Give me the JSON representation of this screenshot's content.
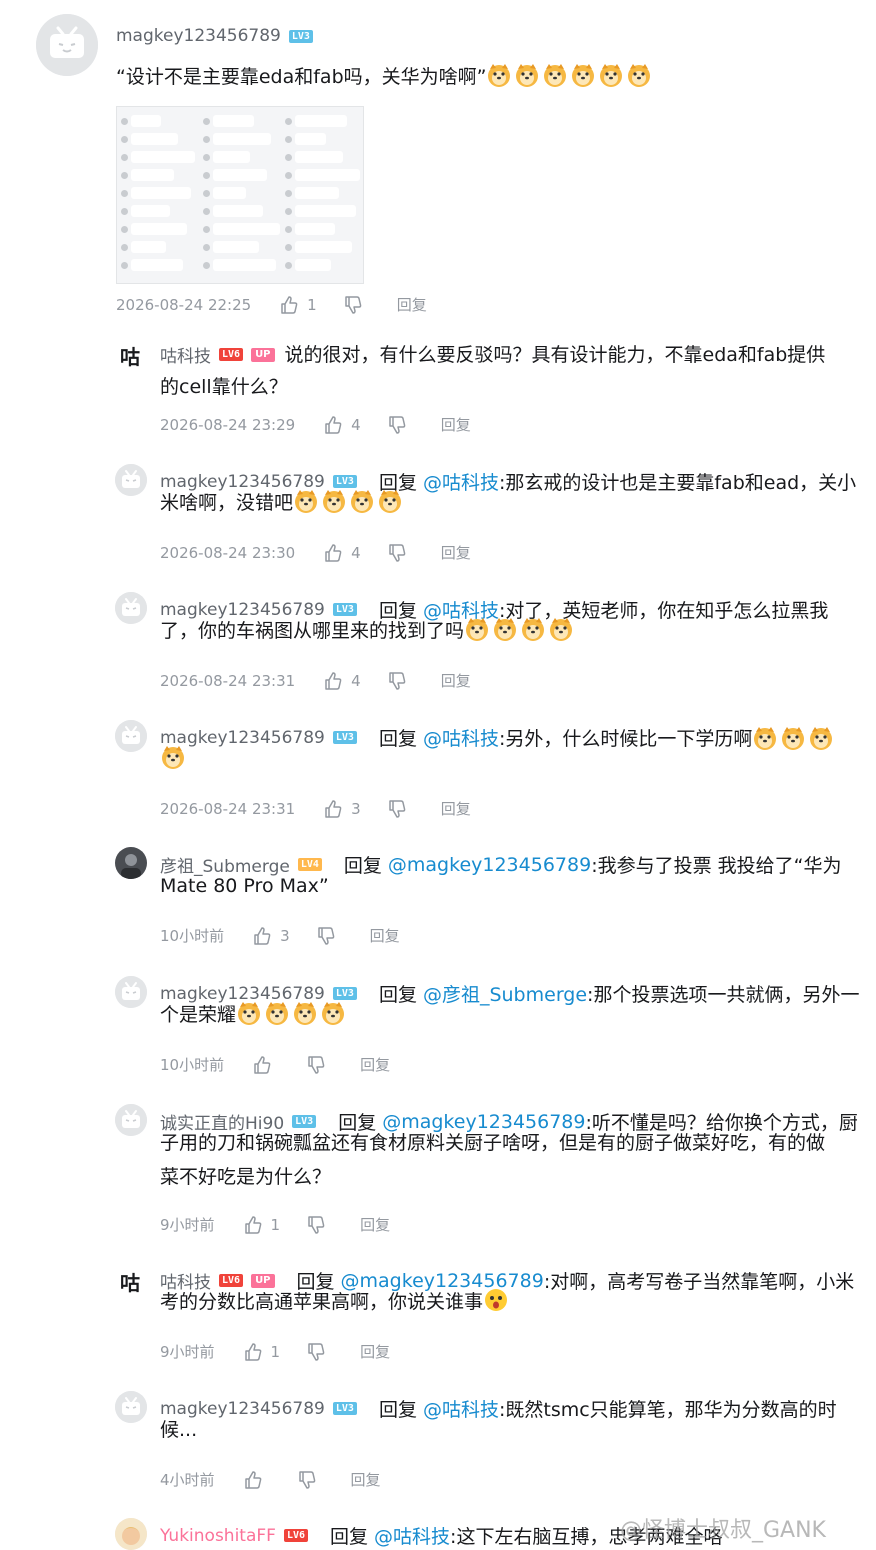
{
  "comments": [
    {
      "user": "magkey123456789",
      "level": "LV3",
      "text": "“设计不是主要靠eda和fab吗，关华为啥啊”",
      "time": "2026-08-24 22:25",
      "likes": "1",
      "reply": "回复"
    },
    {
      "user": "咕科技",
      "level": "LV6",
      "badge": "UP",
      "text_line1": "说的很对，有什么要反驳吗？具有设计能力，不靠eda和fab提供",
      "text_line2": "的cell靠什么？",
      "time": "2026-08-24 23:29",
      "likes": "4",
      "reply": "回复"
    },
    {
      "user": "magkey123456789",
      "level": "LV3",
      "reply_word": "回复",
      "at": "@咕科技",
      "text_line1": ":那玄戒的设计也是主要靠fab和ead，关小",
      "text_line2": "米啥啊，没错吧",
      "time": "2026-08-24 23:30",
      "likes": "4",
      "reply": "回复"
    },
    {
      "user": "magkey123456789",
      "level": "LV3",
      "reply_word": "回复",
      "at": "@咕科技",
      "text_line1": ":对了，英短老师，你在知乎怎么拉黑我",
      "text_line2": "了，你的车祸图从哪里来的找到了吗",
      "time": "2026-08-24 23:31",
      "likes": "4",
      "reply": "回复"
    },
    {
      "user": "magkey123456789",
      "level": "LV3",
      "reply_word": "回复",
      "at": "@咕科技",
      "text_line1": ":另外，什么时候比一下学历啊",
      "time": "2026-08-24 23:31",
      "likes": "3",
      "reply": "回复"
    },
    {
      "user": "彦祖_Submerge",
      "level": "LV4",
      "reply_word": "回复",
      "at": "@magkey123456789",
      "text_line1": ":我参与了投票 我投给了“华为",
      "text_line2": "Mate 80 Pro Max”",
      "time": "10小时前",
      "likes": "3",
      "reply": "回复"
    },
    {
      "user": "magkey123456789",
      "level": "LV3",
      "reply_word": "回复",
      "at": "@彦祖_Submerge",
      "text_line1": ":那个投票选项一共就俩，另外一",
      "text_line2": "个是荣耀",
      "time": "10小时前",
      "reply": "回复"
    },
    {
      "user": "诚实正直的Hi90",
      "level": "LV3",
      "reply_word": "回复",
      "at": "@magkey123456789",
      "text_line1": ":听不懂是吗？给你换个方式，厨",
      "text_line2": "子用的刀和锅碗瓢盆还有食材原料关厨子啥呀，但是有的厨子做菜好吃，有的做",
      "text_line3": "菜不好吃是为什么？",
      "time": "9小时前",
      "likes": "1",
      "reply": "回复"
    },
    {
      "user": "咕科技",
      "level": "LV6",
      "badge": "UP",
      "reply_word": "回复",
      "at": "@magkey123456789",
      "text_line1": ":对啊，高考写卷子当然靠笔啊，小米",
      "text_line2": "考的分数比高通苹果高啊，你说关谁事",
      "time": "9小时前",
      "likes": "1",
      "reply": "回复"
    },
    {
      "user": "magkey123456789",
      "level": "LV3",
      "reply_word": "回复",
      "at": "@咕科技",
      "text_line1": ":既然tsmc只能算笔，那华为分数高的时",
      "text_line2": "候...",
      "time": "4小时前",
      "reply": "回复"
    },
    {
      "user": "YukinoshitaFF",
      "level": "LV6",
      "reply_word": "回复",
      "at": "@咕科技",
      "text_line1": ":这下左右脑互搏，忠孝两难全咯"
    }
  ],
  "gu_avatar_char": "咕",
  "watermark": "@怪博士叔叔_GANK",
  "colors": {
    "accent_blue": "#178bcf",
    "up_pink": "#fb7299",
    "muted": "#9499a0"
  }
}
